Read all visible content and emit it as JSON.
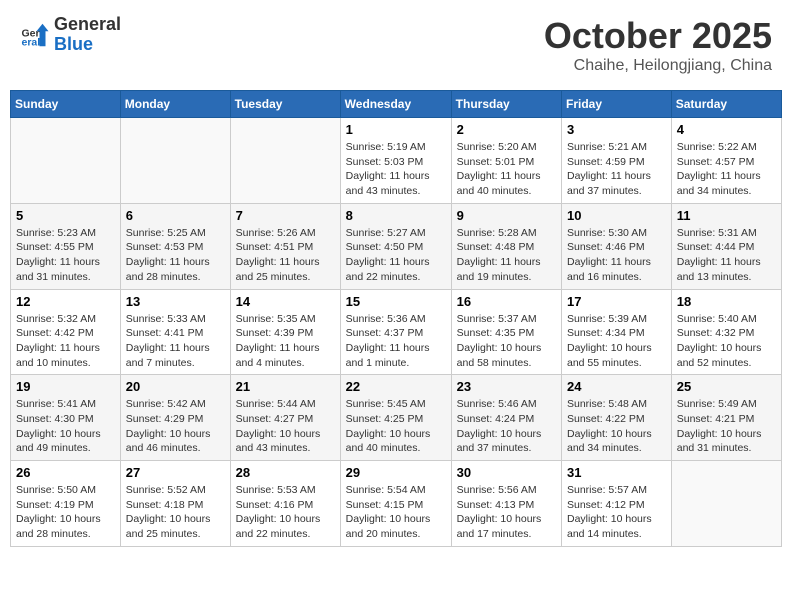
{
  "header": {
    "logo_general": "General",
    "logo_blue": "Blue",
    "month_title": "October 2025",
    "subtitle": "Chaihe, Heilongjiang, China"
  },
  "days_of_week": [
    "Sunday",
    "Monday",
    "Tuesday",
    "Wednesday",
    "Thursday",
    "Friday",
    "Saturday"
  ],
  "weeks": [
    [
      {
        "day": "",
        "info": ""
      },
      {
        "day": "",
        "info": ""
      },
      {
        "day": "",
        "info": ""
      },
      {
        "day": "1",
        "sunrise": "5:19 AM",
        "sunset": "5:03 PM",
        "daylight": "11 hours and 43 minutes."
      },
      {
        "day": "2",
        "sunrise": "5:20 AM",
        "sunset": "5:01 PM",
        "daylight": "11 hours and 40 minutes."
      },
      {
        "day": "3",
        "sunrise": "5:21 AM",
        "sunset": "4:59 PM",
        "daylight": "11 hours and 37 minutes."
      },
      {
        "day": "4",
        "sunrise": "5:22 AM",
        "sunset": "4:57 PM",
        "daylight": "11 hours and 34 minutes."
      }
    ],
    [
      {
        "day": "5",
        "sunrise": "5:23 AM",
        "sunset": "4:55 PM",
        "daylight": "11 hours and 31 minutes."
      },
      {
        "day": "6",
        "sunrise": "5:25 AM",
        "sunset": "4:53 PM",
        "daylight": "11 hours and 28 minutes."
      },
      {
        "day": "7",
        "sunrise": "5:26 AM",
        "sunset": "4:51 PM",
        "daylight": "11 hours and 25 minutes."
      },
      {
        "day": "8",
        "sunrise": "5:27 AM",
        "sunset": "4:50 PM",
        "daylight": "11 hours and 22 minutes."
      },
      {
        "day": "9",
        "sunrise": "5:28 AM",
        "sunset": "4:48 PM",
        "daylight": "11 hours and 19 minutes."
      },
      {
        "day": "10",
        "sunrise": "5:30 AM",
        "sunset": "4:46 PM",
        "daylight": "11 hours and 16 minutes."
      },
      {
        "day": "11",
        "sunrise": "5:31 AM",
        "sunset": "4:44 PM",
        "daylight": "11 hours and 13 minutes."
      }
    ],
    [
      {
        "day": "12",
        "sunrise": "5:32 AM",
        "sunset": "4:42 PM",
        "daylight": "11 hours and 10 minutes."
      },
      {
        "day": "13",
        "sunrise": "5:33 AM",
        "sunset": "4:41 PM",
        "daylight": "11 hours and 7 minutes."
      },
      {
        "day": "14",
        "sunrise": "5:35 AM",
        "sunset": "4:39 PM",
        "daylight": "11 hours and 4 minutes."
      },
      {
        "day": "15",
        "sunrise": "5:36 AM",
        "sunset": "4:37 PM",
        "daylight": "11 hours and 1 minute."
      },
      {
        "day": "16",
        "sunrise": "5:37 AM",
        "sunset": "4:35 PM",
        "daylight": "10 hours and 58 minutes."
      },
      {
        "day": "17",
        "sunrise": "5:39 AM",
        "sunset": "4:34 PM",
        "daylight": "10 hours and 55 minutes."
      },
      {
        "day": "18",
        "sunrise": "5:40 AM",
        "sunset": "4:32 PM",
        "daylight": "10 hours and 52 minutes."
      }
    ],
    [
      {
        "day": "19",
        "sunrise": "5:41 AM",
        "sunset": "4:30 PM",
        "daylight": "10 hours and 49 minutes."
      },
      {
        "day": "20",
        "sunrise": "5:42 AM",
        "sunset": "4:29 PM",
        "daylight": "10 hours and 46 minutes."
      },
      {
        "day": "21",
        "sunrise": "5:44 AM",
        "sunset": "4:27 PM",
        "daylight": "10 hours and 43 minutes."
      },
      {
        "day": "22",
        "sunrise": "5:45 AM",
        "sunset": "4:25 PM",
        "daylight": "10 hours and 40 minutes."
      },
      {
        "day": "23",
        "sunrise": "5:46 AM",
        "sunset": "4:24 PM",
        "daylight": "10 hours and 37 minutes."
      },
      {
        "day": "24",
        "sunrise": "5:48 AM",
        "sunset": "4:22 PM",
        "daylight": "10 hours and 34 minutes."
      },
      {
        "day": "25",
        "sunrise": "5:49 AM",
        "sunset": "4:21 PM",
        "daylight": "10 hours and 31 minutes."
      }
    ],
    [
      {
        "day": "26",
        "sunrise": "5:50 AM",
        "sunset": "4:19 PM",
        "daylight": "10 hours and 28 minutes."
      },
      {
        "day": "27",
        "sunrise": "5:52 AM",
        "sunset": "4:18 PM",
        "daylight": "10 hours and 25 minutes."
      },
      {
        "day": "28",
        "sunrise": "5:53 AM",
        "sunset": "4:16 PM",
        "daylight": "10 hours and 22 minutes."
      },
      {
        "day": "29",
        "sunrise": "5:54 AM",
        "sunset": "4:15 PM",
        "daylight": "10 hours and 20 minutes."
      },
      {
        "day": "30",
        "sunrise": "5:56 AM",
        "sunset": "4:13 PM",
        "daylight": "10 hours and 17 minutes."
      },
      {
        "day": "31",
        "sunrise": "5:57 AM",
        "sunset": "4:12 PM",
        "daylight": "10 hours and 14 minutes."
      },
      {
        "day": "",
        "info": ""
      }
    ]
  ]
}
